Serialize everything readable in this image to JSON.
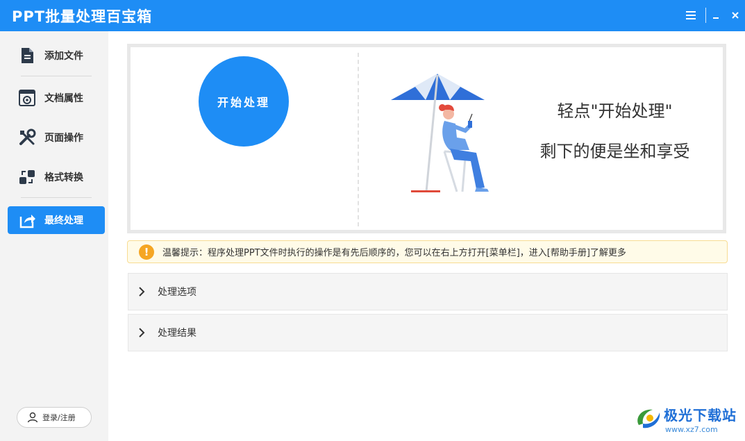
{
  "window": {
    "title": "PPT批量处理百宝箱",
    "menu_icon": "hamburger-menu-icon",
    "minimize_icon": "minimize-icon",
    "close_icon": "close-icon"
  },
  "sidebar": {
    "items": [
      {
        "label": "添加文件",
        "icon": "document-icon",
        "active": false
      },
      {
        "label": "文档属性",
        "icon": "document-settings-icon",
        "active": false
      },
      {
        "label": "页面操作",
        "icon": "tools-icon",
        "active": false
      },
      {
        "label": "格式转换",
        "icon": "convert-icon",
        "active": false
      },
      {
        "label": "最终处理",
        "icon": "share-icon",
        "active": true
      }
    ],
    "login_label": "登录/注册",
    "login_icon": "user-icon"
  },
  "hero": {
    "start_button": "开始处理",
    "line1": "轻点\"开始处理\"",
    "line2": "剩下的便是坐和享受",
    "illustration": "woman-under-umbrella-illustration"
  },
  "tip": {
    "icon": "warning-icon",
    "text": "温馨提示：程序处理PPT文件时执行的操作是有先后顺序的，您可以在右上方打开[菜单栏]，进入[帮助手册]了解更多"
  },
  "sections": [
    {
      "label": "处理选项",
      "icon": "chevron-right-icon"
    },
    {
      "label": "处理结果",
      "icon": "chevron-right-icon"
    }
  ],
  "watermark": {
    "main": "极光下载站",
    "sub": "www.xz7.com"
  },
  "colors": {
    "accent": "#1e8df5",
    "sidebar_bg": "#f3f3f3",
    "tip_bg": "#fffbe8",
    "tip_icon": "#f5a623"
  }
}
